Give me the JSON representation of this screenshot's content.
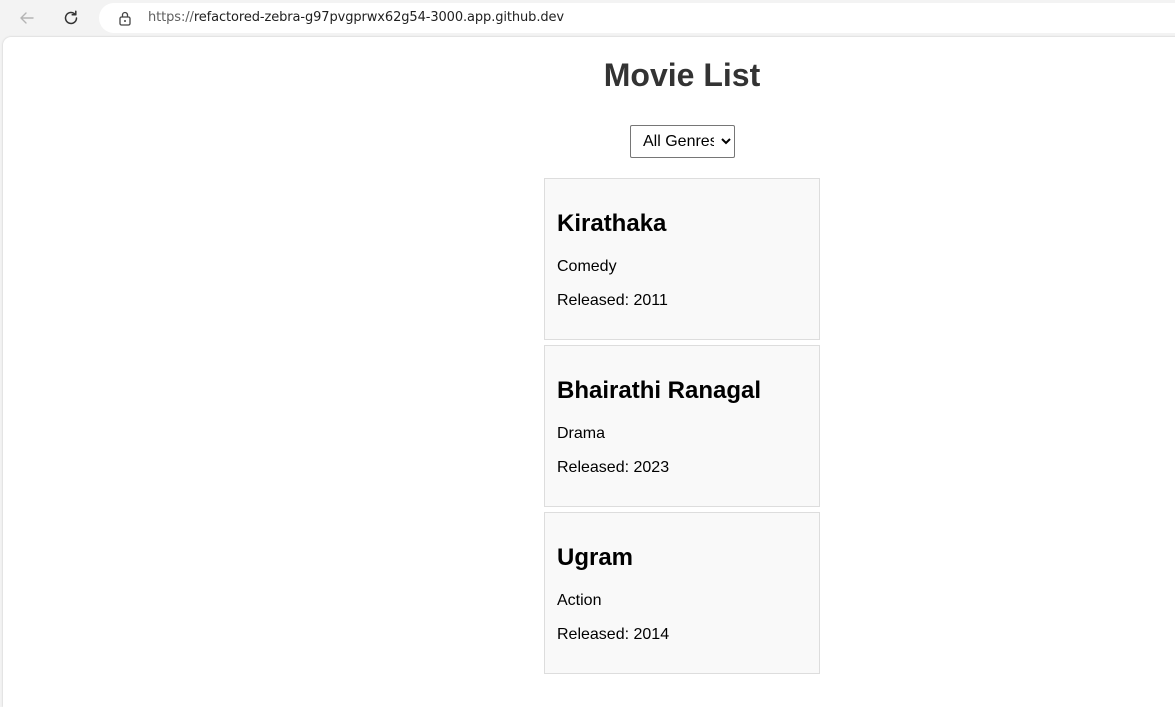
{
  "browser": {
    "url_scheme": "https://",
    "url_rest": "refactored-zebra-g97pvgprwx62g54-3000.app.github.dev"
  },
  "page": {
    "title": "Movie List"
  },
  "filter": {
    "selected": "All Genres"
  },
  "movies": [
    {
      "title": "Kirathaka",
      "genre": "Comedy",
      "released": "Released: 2011"
    },
    {
      "title": "Bhairathi Ranagal",
      "genre": "Drama",
      "released": "Released: 2023"
    },
    {
      "title": "Ugram",
      "genre": "Action",
      "released": "Released: 2014"
    }
  ]
}
